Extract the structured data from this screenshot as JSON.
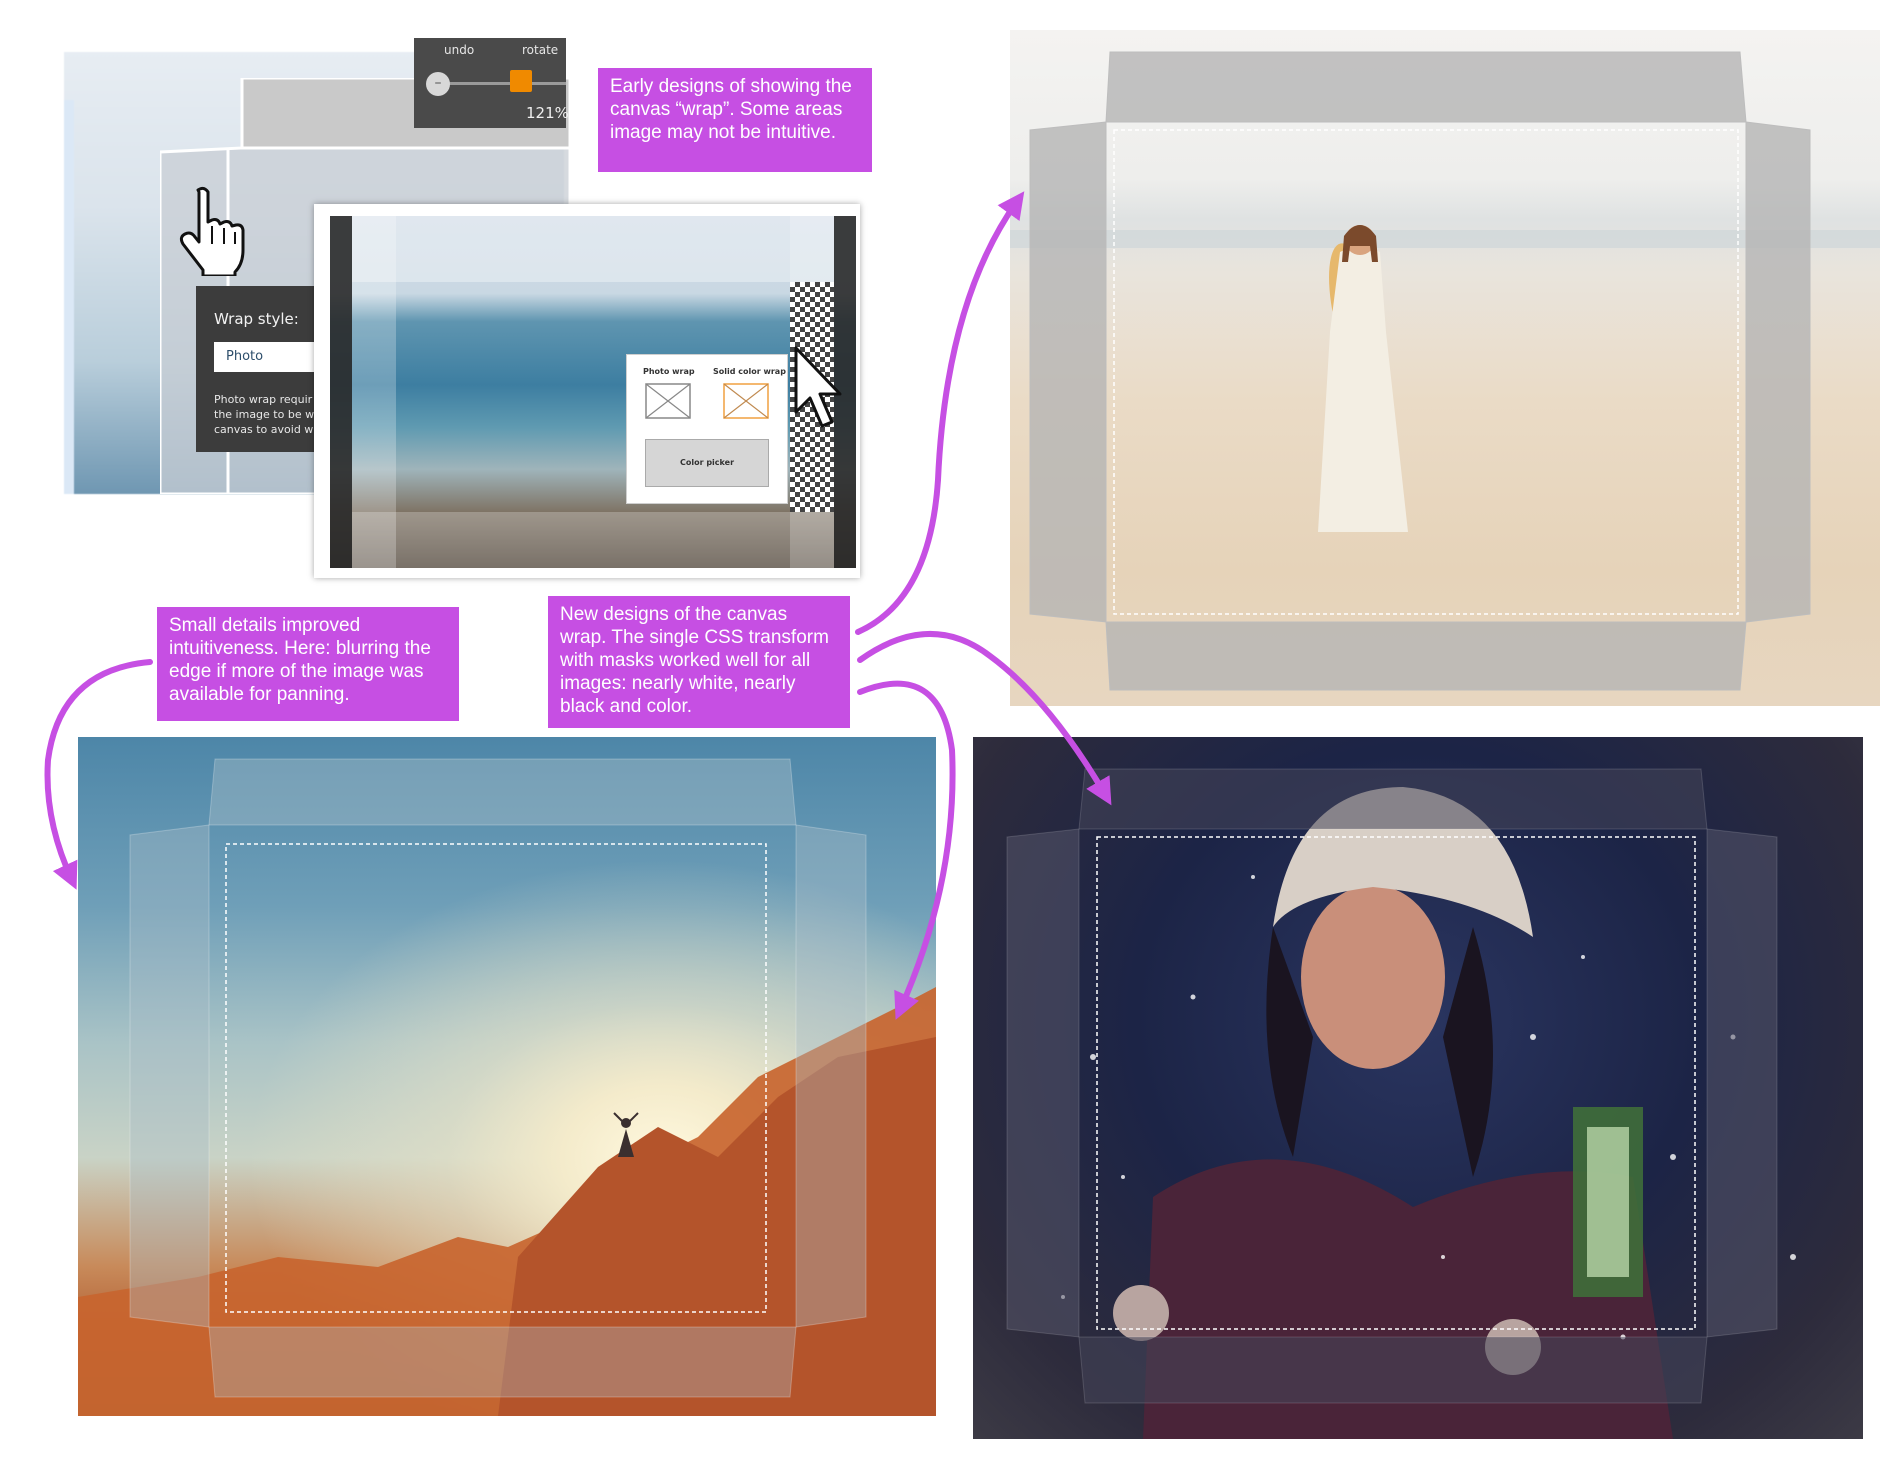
{
  "toolbar": {
    "undo_label": "undo",
    "rotate_label": "rotate",
    "minus_label": "–",
    "zoom_value": "121%"
  },
  "wrap_style_panel": {
    "title": "Wrap style:",
    "selected": "Photo",
    "description_lines": [
      "Photo wrap requir",
      "the image to be w",
      "canvas to avoid wh"
    ]
  },
  "wrap_options_popup": {
    "photo_wrap_label": "Photo wrap",
    "solid_color_wrap_label": "Solid color wrap",
    "color_picker_label": "Color picker"
  },
  "callouts": {
    "early": "Early designs of showing the canvas “wrap”. Some areas image may not be intuitive.",
    "small_details": "Small details improved intuitiveness. Here: blurring the edge if more of the image was available for panning.",
    "new_designs": "New designs of the canvas wrap. The single CSS transform with masks worked well for all images: nearly white, nearly black and color."
  },
  "colors": {
    "callout_bg": "#c64fe3",
    "arrow": "#c64fe3",
    "toolbar_bg": "#4a4a4a",
    "zoom_knob": "#f08a00",
    "panel_bg": "#3c3c3c"
  },
  "icons": [
    "hand-cursor-icon",
    "arrow-cursor-icon",
    "photo-wrap-icon",
    "solid-color-wrap-icon",
    "zoom-out-icon"
  ]
}
